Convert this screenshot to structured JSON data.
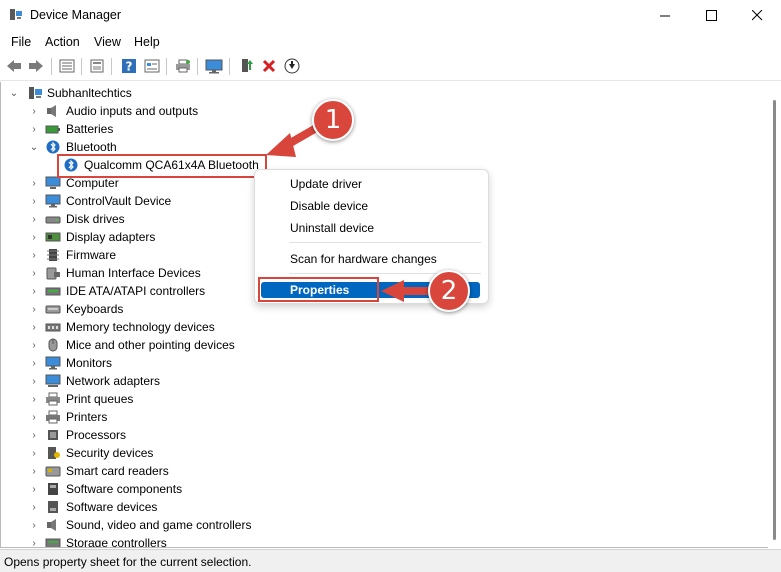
{
  "window": {
    "title": "Device Manager",
    "minimize_glyph": "—",
    "maximize_glyph": "☐",
    "close_glyph": "✕"
  },
  "menu": [
    "File",
    "Action",
    "View",
    "Help"
  ],
  "toolbar": {
    "icons": [
      "back-icon",
      "forward-icon",
      "device-list-icon",
      "properties-icon",
      "help-icon",
      "view-icon",
      "print-icon",
      "monitor-icon",
      "update-driver-icon",
      "uninstall-icon",
      "download-icon"
    ]
  },
  "tree": {
    "root": "Subhanltechtics",
    "items": [
      {
        "label": "Audio inputs and outputs",
        "icon": "speaker-icon",
        "expanded": false
      },
      {
        "label": "Batteries",
        "icon": "battery-icon",
        "expanded": false
      },
      {
        "label": "Bluetooth",
        "icon": "bluetooth-icon",
        "expanded": true
      },
      {
        "label": "Qualcomm QCA61x4A Bluetooth",
        "icon": "bluetooth-icon",
        "child": true,
        "selected": true
      },
      {
        "label": "Computer",
        "icon": "computer-icon",
        "expanded": false
      },
      {
        "label": "ControlVault Device",
        "icon": "monitor-icon",
        "expanded": false
      },
      {
        "label": "Disk drives",
        "icon": "disk-icon",
        "expanded": false
      },
      {
        "label": "Display adapters",
        "icon": "display-adapter-icon",
        "expanded": false
      },
      {
        "label": "Firmware",
        "icon": "firmware-icon",
        "expanded": false
      },
      {
        "label": "Human Interface Devices",
        "icon": "hid-icon",
        "expanded": false
      },
      {
        "label": "IDE ATA/ATAPI controllers",
        "icon": "ide-icon",
        "expanded": false
      },
      {
        "label": "Keyboards",
        "icon": "keyboard-icon",
        "expanded": false
      },
      {
        "label": "Memory technology devices",
        "icon": "memory-icon",
        "expanded": false
      },
      {
        "label": "Mice and other pointing devices",
        "icon": "mouse-icon",
        "expanded": false
      },
      {
        "label": "Monitors",
        "icon": "monitor-icon",
        "expanded": false
      },
      {
        "label": "Network adapters",
        "icon": "network-icon",
        "expanded": false
      },
      {
        "label": "Print queues",
        "icon": "print-queue-icon",
        "expanded": false
      },
      {
        "label": "Printers",
        "icon": "printer-icon",
        "expanded": false
      },
      {
        "label": "Processors",
        "icon": "processor-icon",
        "expanded": false
      },
      {
        "label": "Security devices",
        "icon": "security-icon",
        "expanded": false
      },
      {
        "label": "Smart card readers",
        "icon": "smart-card-icon",
        "expanded": false
      },
      {
        "label": "Software components",
        "icon": "software-component-icon",
        "expanded": false
      },
      {
        "label": "Software devices",
        "icon": "software-device-icon",
        "expanded": false
      },
      {
        "label": "Sound, video and game controllers",
        "icon": "sound-icon",
        "expanded": false
      },
      {
        "label": "Storage controllers",
        "icon": "storage-icon",
        "expanded": false
      }
    ]
  },
  "context_menu": {
    "items": [
      "Update driver",
      "Disable device",
      "Uninstall device",
      "Scan for hardware changes",
      "Properties"
    ]
  },
  "annotations": {
    "callout_1": "1",
    "callout_2": "2",
    "accent": "#d8453b"
  },
  "status": "Opens property sheet for the current selection.",
  "colors": {
    "selection": "#0067c0",
    "annotation_red": "#d8453b"
  }
}
